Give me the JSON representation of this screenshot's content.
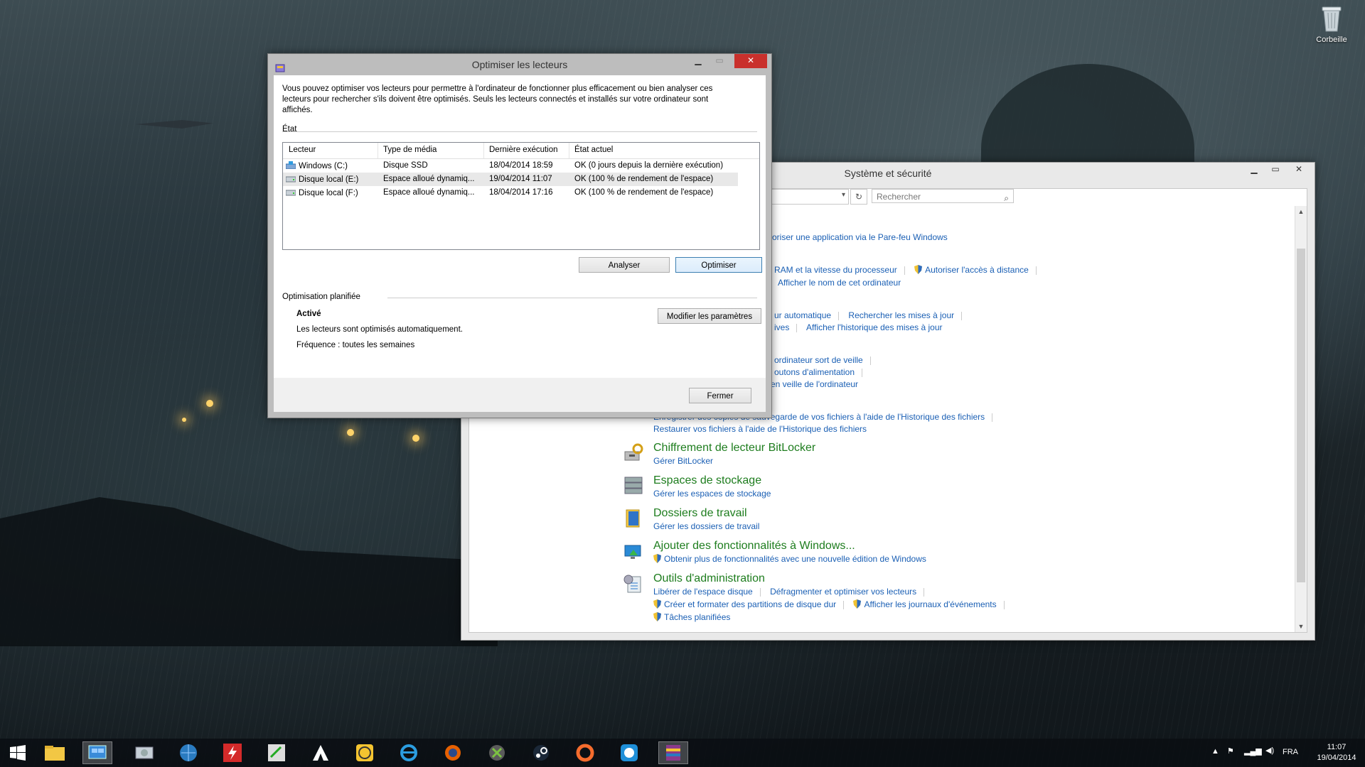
{
  "desktop": {
    "recycle_bin_label": "Corbeille"
  },
  "system_window": {
    "title": "Système et sécurité",
    "search_placeholder": "Rechercher",
    "partial_links": {
      "firewall": "oriser une application via le Pare-feu Windows",
      "ram": "RAM et la vitesse du processeur",
      "remote": "Autoriser l'accès à distance",
      "computer_name": "Afficher le nom de cet ordinateur",
      "auto_update": "ur automatique",
      "check_updates": "Rechercher les mises à jour",
      "ives": "ives",
      "update_history": "Afficher l'historique des mises à jour",
      "sleep": "ordinateur sort de veille",
      "power_buttons": "outons d'alimentation",
      "sleep2": "en veille de l'ordinateur",
      "history_save": "Enregistrer des copies de sauvegarde de vos fichiers à l'aide de l'Historique des fichiers",
      "history_restore": "Restaurer vos fichiers à l'aide de l'Historique des fichiers"
    },
    "categories": [
      {
        "title": "Chiffrement de lecteur BitLocker",
        "links": [
          "Gérer BitLocker"
        ]
      },
      {
        "title": "Espaces de stockage",
        "links": [
          "Gérer les espaces de stockage"
        ]
      },
      {
        "title": "Dossiers de travail",
        "links": [
          "Gérer les dossiers de travail"
        ]
      },
      {
        "title": "Ajouter des fonctionnalités à Windows...",
        "links": [
          "Obtenir plus de fonctionnalités avec une nouvelle édition de Windows"
        ]
      },
      {
        "title": "Outils d'administration",
        "links": [
          "Libérer de l'espace disque",
          "Défragmenter et optimiser vos lecteurs",
          "Créer et formater des partitions de disque dur",
          "Afficher les journaux d'événements",
          "Tâches planifiées"
        ]
      }
    ]
  },
  "optimize_dialog": {
    "title": "Optimiser les lecteurs",
    "description": "Vous pouvez optimiser vos lecteurs pour permettre à l'ordinateur de fonctionner plus efficacement ou bien analyser ces lecteurs pour rechercher s'ils doivent être optimisés. Seuls les lecteurs connectés et installés sur votre ordinateur sont affichés.",
    "status_label": "État",
    "columns": [
      "Lecteur",
      "Type de média",
      "Dernière exécution",
      "État actuel"
    ],
    "drives": [
      {
        "name": "Windows (C:)",
        "media": "Disque SSD",
        "last_run": "18/04/2014 18:59",
        "status": "OK (0 jours depuis la dernière exécution)"
      },
      {
        "name": "Disque local (E:)",
        "media": "Espace alloué dynamiq...",
        "last_run": "19/04/2014 11:07",
        "status": "OK (100 % de rendement de l'espace)"
      },
      {
        "name": "Disque local (F:)",
        "media": "Espace alloué dynamiq...",
        "last_run": "18/04/2014 17:16",
        "status": "OK (100 % de rendement de l'espace)"
      }
    ],
    "analyze_button": "Analyser",
    "optimize_button": "Optimiser",
    "scheduled_label": "Optimisation planifiée",
    "scheduled_state": "Activé",
    "scheduled_desc": "Les lecteurs sont optimisés automatiquement.",
    "frequency": "Fréquence : toutes les semaines",
    "change_settings_button": "Modifier les paramètres",
    "close_button": "Fermer"
  },
  "taskbar": {
    "language": "FRA",
    "time": "11:07",
    "date": "19/04/2014",
    "icons": [
      "start-icon",
      "file-explorer-icon",
      "control-panel-icon",
      "disk-icon",
      "globe-icon",
      "flash-icon",
      "bioshock-icon",
      "alienware-icon",
      "network-icon",
      "internet-explorer-icon",
      "firefox-icon",
      "xbox-icon",
      "steam-icon",
      "origin-icon",
      "uplay-icon",
      "winrar-icon"
    ]
  }
}
